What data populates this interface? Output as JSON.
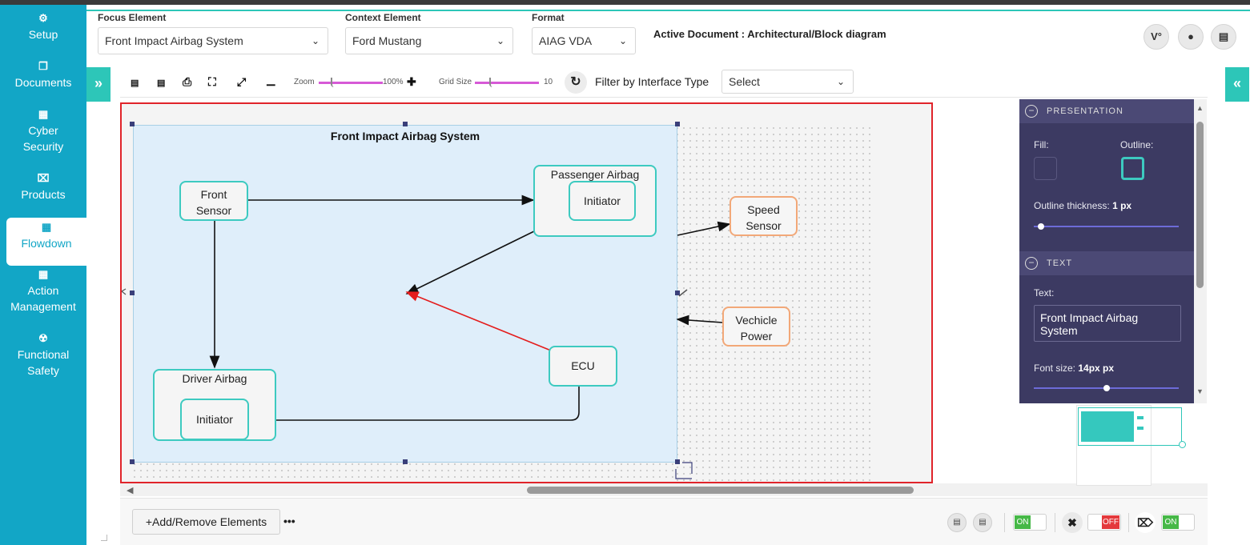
{
  "sidebar": {
    "items": [
      {
        "label": "Setup",
        "icon": "gears-icon"
      },
      {
        "label": "Documents",
        "icon": "documents-icon"
      },
      {
        "label": "Cyber Security",
        "icon": "building-icon"
      },
      {
        "label": "Products",
        "icon": "flag-icon"
      },
      {
        "label": "Flowdown",
        "icon": "building-icon"
      },
      {
        "label": "Action Management",
        "icon": "building-icon"
      },
      {
        "label": "Functional Safety",
        "icon": "radiation-icon"
      }
    ],
    "active": "Flowdown"
  },
  "header": {
    "focus_label": "Focus Element",
    "focus_value": "Front Impact Airbag System",
    "context_label": "Context Element",
    "context_value": "Ford Mustang",
    "format_label": "Format",
    "format_value": "AIAG VDA",
    "active_document": "Active Document : Architectural/Block diagram"
  },
  "toolbar": {
    "zoom_label": "Zoom",
    "zoom_value": "100%",
    "grid_label": "Grid Size",
    "grid_value": "10",
    "filter_label": "Filter by Interface Type",
    "filter_value": "Select"
  },
  "diagram": {
    "system_title": "Front Impact Airbag System",
    "nodes": {
      "front_sensor": "Front Sensor",
      "passenger_airbag": "Passenger Airbag",
      "passenger_initiator": "Initiator",
      "speed_sensor": "Speed Sensor",
      "vehicle_power": "Vechicle Power",
      "ecu": "ECU",
      "driver_airbag": "Driver Airbag",
      "driver_initiator": "Initiator"
    },
    "colors": {
      "inner_border": "#3dcac0",
      "outer_border": "#f2a878",
      "selected_arrow": "#e41c1c",
      "selection_outline": "#e0242a"
    }
  },
  "properties": {
    "presentation_header": "PRESENTATION",
    "fill_label": "Fill:",
    "outline_label": "Outline:",
    "outline_thickness_label": "Outline thickness:",
    "outline_thickness_value": "1 px",
    "outline_thickness_level": 0.05,
    "text_header": "TEXT",
    "text_label": "Text:",
    "text_value": "Front Impact Airbag System",
    "font_size_label": "Font size:",
    "font_size_value": "14px px",
    "font_size_level": 0.5,
    "fill_color": "#3c3a62",
    "outline_color": "#3dcac0"
  },
  "bottombar": {
    "add_remove_label": "+Add/Remove Elements",
    "more_label": "•••",
    "toggle1": "ON",
    "toggle2": "OFF",
    "toggle3": "ON"
  }
}
